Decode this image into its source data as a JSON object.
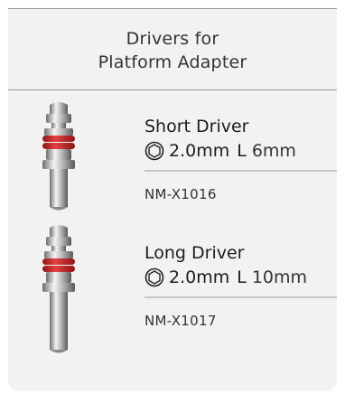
{
  "header": {
    "line1": "Drivers for",
    "line2": "Platform Adapter"
  },
  "products": [
    {
      "name": "Short Driver",
      "size": "2.0mm",
      "length_label": "L",
      "length": "6mm",
      "code": "NM-X1016"
    },
    {
      "name": "Long Driver",
      "size": "2.0mm",
      "length_label": "L",
      "length": "10mm",
      "code": "NM-X1017"
    }
  ],
  "colors": {
    "band": "#d42a2a",
    "metal": "#b8b8b8",
    "card": "#f2f2f2"
  },
  "icons": {
    "hex": "hexagon-socket-icon"
  }
}
